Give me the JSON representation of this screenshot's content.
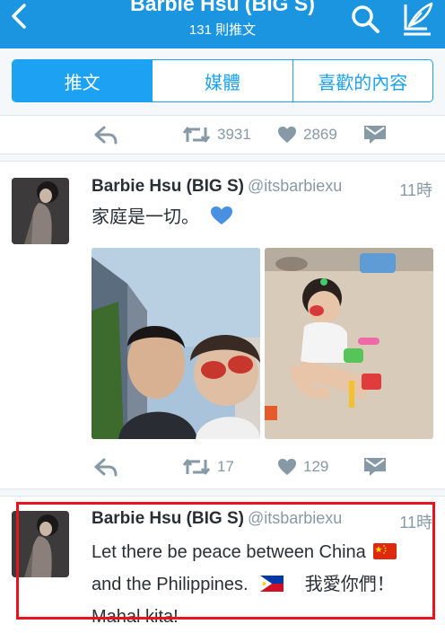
{
  "header": {
    "title": "Barbie Hsu (BIG S)",
    "subtitle": "131 則推文"
  },
  "tabs": [
    {
      "label": "推文",
      "active": true
    },
    {
      "label": "媒體",
      "active": false
    },
    {
      "label": "喜歡的內容",
      "active": false
    }
  ],
  "prev_tweet_actions": {
    "retweets": "3931",
    "likes": "2869"
  },
  "tweets": [
    {
      "name": "Barbie Hsu (BIG S)",
      "handle": "@itsbarbiexu",
      "time": "11時",
      "text": "家庭是一切。",
      "emoji": "blue-heart",
      "retweets": "17",
      "likes": "129"
    },
    {
      "name": "Barbie Hsu (BIG S)",
      "handle": "@itsbarbiexu",
      "time": "11時",
      "text_line1": "Let there be peace between China",
      "text_line2": "and the Philippines.",
      "text_line2_cjk": "我愛你們！",
      "text_line3": "Mahal kita!",
      "flags": [
        "china-flag",
        "philippines-flag"
      ]
    }
  ],
  "colors": {
    "header": "#1b95e0",
    "accent": "#1da1f2",
    "muted": "#8899a6",
    "highlight": "#e8141d"
  }
}
